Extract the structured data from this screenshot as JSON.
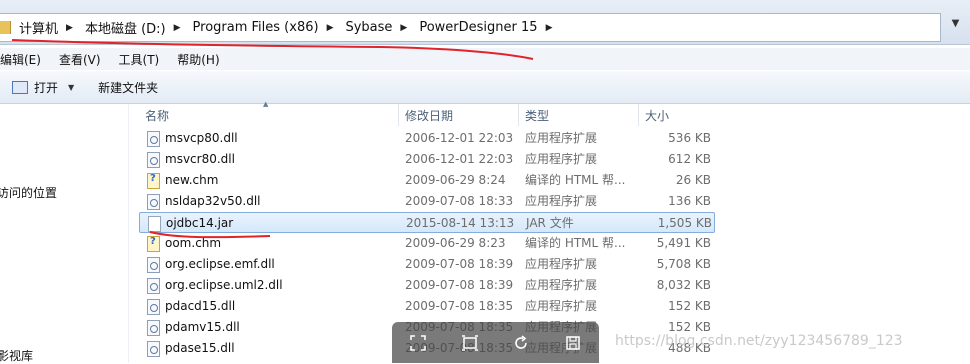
{
  "address": {
    "crumbs": [
      "计算机",
      "本地磁盘 (D:)",
      "Program Files (x86)",
      "Sybase",
      "PowerDesigner 15"
    ]
  },
  "menu": [
    "编辑(E)",
    "查看(V)",
    "工具(T)",
    "帮助(H)"
  ],
  "toolbar": {
    "open_label": "打开",
    "new_folder_label": "新建文件夹"
  },
  "nav": [
    "访问的位置",
    "影视库"
  ],
  "columns": {
    "name": "名称",
    "date": "修改日期",
    "type": "类型",
    "size": "大小"
  },
  "files": [
    {
      "name": "msvcp80.dll",
      "date": "2006-12-01 22:03",
      "type": "应用程序扩展",
      "size": "536 KB",
      "icon": "dll-icon"
    },
    {
      "name": "msvcr80.dll",
      "date": "2006-12-01 22:03",
      "type": "应用程序扩展",
      "size": "612 KB",
      "icon": "dll-icon"
    },
    {
      "name": "new.chm",
      "date": "2009-06-29 8:24",
      "type": "编译的 HTML 帮...",
      "size": "26 KB",
      "icon": "chm-icon"
    },
    {
      "name": "nsldap32v50.dll",
      "date": "2009-07-08 18:33",
      "type": "应用程序扩展",
      "size": "136 KB",
      "icon": "dll-icon"
    },
    {
      "name": "ojdbc14.jar",
      "date": "2015-08-14 13:13",
      "type": "JAR 文件",
      "size": "1,505 KB",
      "icon": "jar-icon"
    },
    {
      "name": "oom.chm",
      "date": "2009-06-29 8:23",
      "type": "编译的 HTML 帮...",
      "size": "5,491 KB",
      "icon": "chm-icon"
    },
    {
      "name": "org.eclipse.emf.dll",
      "date": "2009-07-08 18:39",
      "type": "应用程序扩展",
      "size": "5,708 KB",
      "icon": "dll-icon"
    },
    {
      "name": "org.eclipse.uml2.dll",
      "date": "2009-07-08 18:39",
      "type": "应用程序扩展",
      "size": "8,032 KB",
      "icon": "dll-icon"
    },
    {
      "name": "pdacd15.dll",
      "date": "2009-07-08 18:35",
      "type": "应用程序扩展",
      "size": "152 KB",
      "icon": "dll-icon"
    },
    {
      "name": "pdamv15.dll",
      "date": "2009-07-08 18:35",
      "type": "应用程序扩展",
      "size": "152 KB",
      "icon": "dll-icon"
    },
    {
      "name": "pdase15.dll",
      "date": "2009-07-08 18:35",
      "type": "应用程序扩展",
      "size": "488 KB",
      "icon": "dll-icon"
    }
  ],
  "selected_index": 4,
  "watermark": "https://blog.csdn.net/zyy123456789_123",
  "colors": {
    "annotation": "#e0242a",
    "selection_border": "#84acdd"
  }
}
